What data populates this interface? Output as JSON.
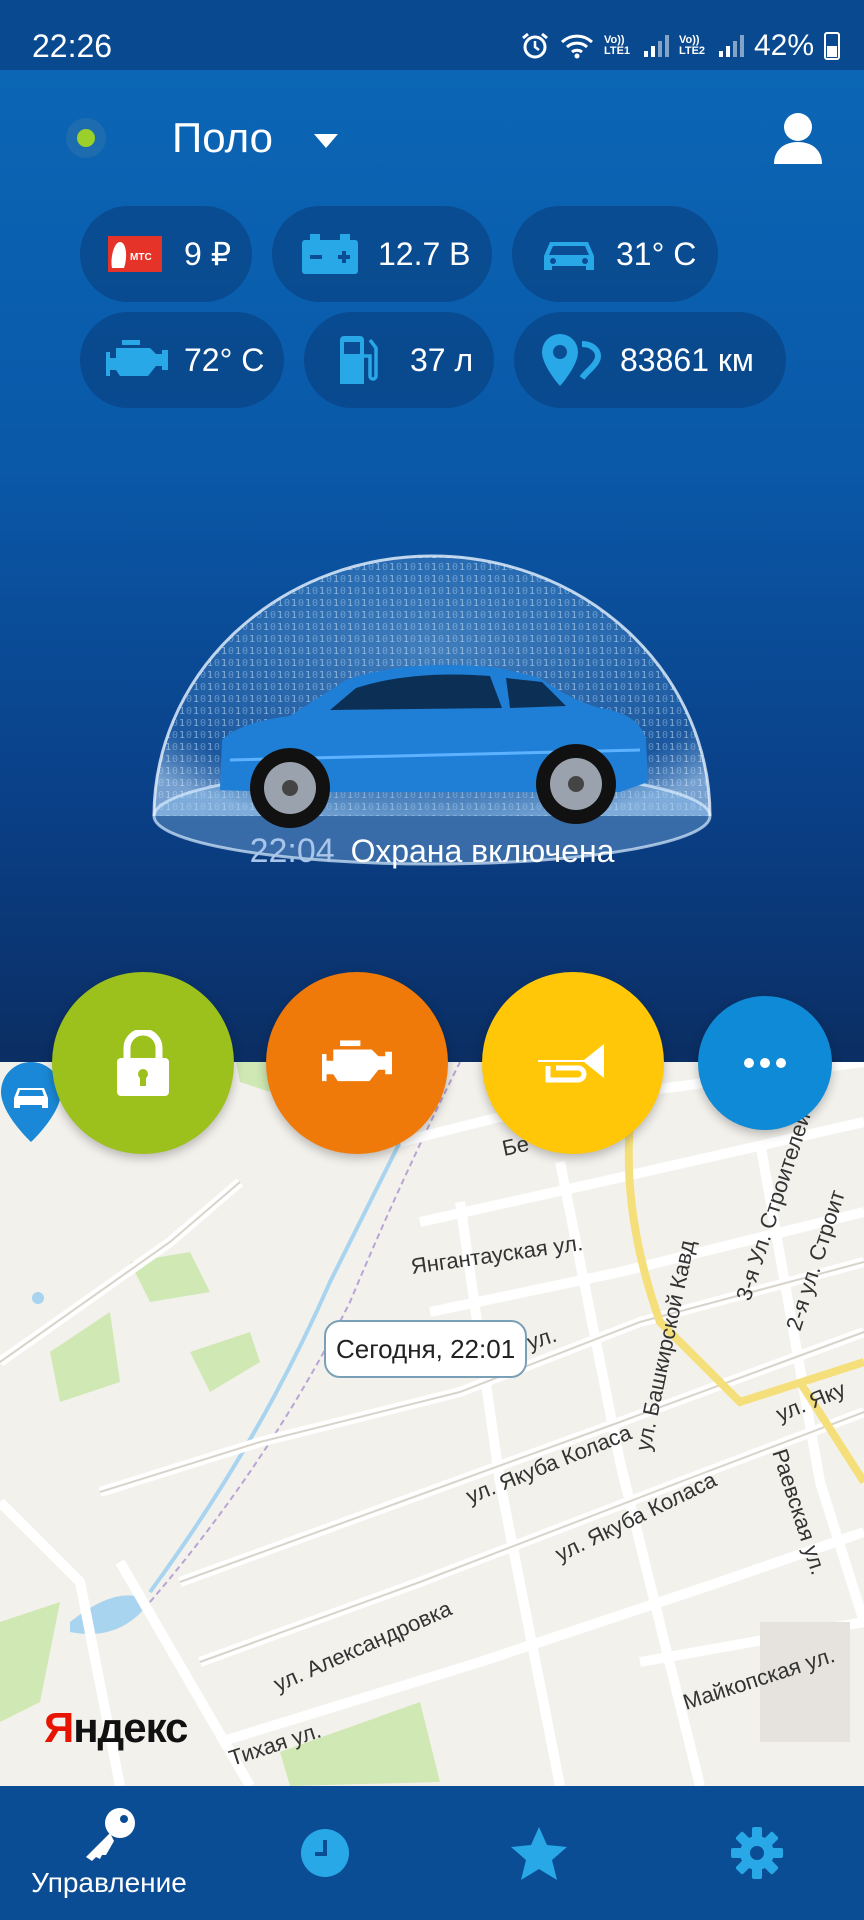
{
  "status_bar": {
    "time": "22:26",
    "sim1_label": "Vo)) LTE1",
    "sim2_label": "Vo)) LTE2",
    "battery": "42%"
  },
  "header": {
    "car_name": "Поло"
  },
  "indicators": {
    "balance": "9 ₽",
    "balance_operator": "МТС",
    "voltage": "12.7 В",
    "cabin_temp": "31° С",
    "engine_temp": "72° С",
    "fuel": "37 л",
    "mileage": "83861 км"
  },
  "security": {
    "time": "22:04",
    "text": "Охрана включена"
  },
  "map": {
    "bubble_text": "Сегодня, 22:01",
    "brand_first": "Я",
    "brand_rest": "ндекс",
    "streets": {
      "yangantau": "Янгантауская ул.",
      "bashkir": "ул. Башкирской Кавд",
      "stroiteley3": "3-я Ул. Строителей",
      "stroiteley2": "2-я ул. Строит",
      "yakub1": "ул. Якуба Коласа",
      "yakub2": "ул. Якуба Коласа",
      "yakub3": "ул. Яку",
      "alexandrovka": "ул. Александровка",
      "raevskaya": "Раевская ул.",
      "maykopskaya": "Майкопская ул.",
      "tikhaya": "Тихая ул.",
      "ul_fragment": "ул.",
      "be": "Бе"
    }
  },
  "bottom_nav": {
    "control_label": "Управление"
  },
  "colors": {
    "accent_green": "#9cc01c",
    "accent_orange": "#ef7a0a",
    "accent_yellow": "#ffc707",
    "accent_blue": "#0f8ad6",
    "icon_blue": "#29a8e8"
  }
}
